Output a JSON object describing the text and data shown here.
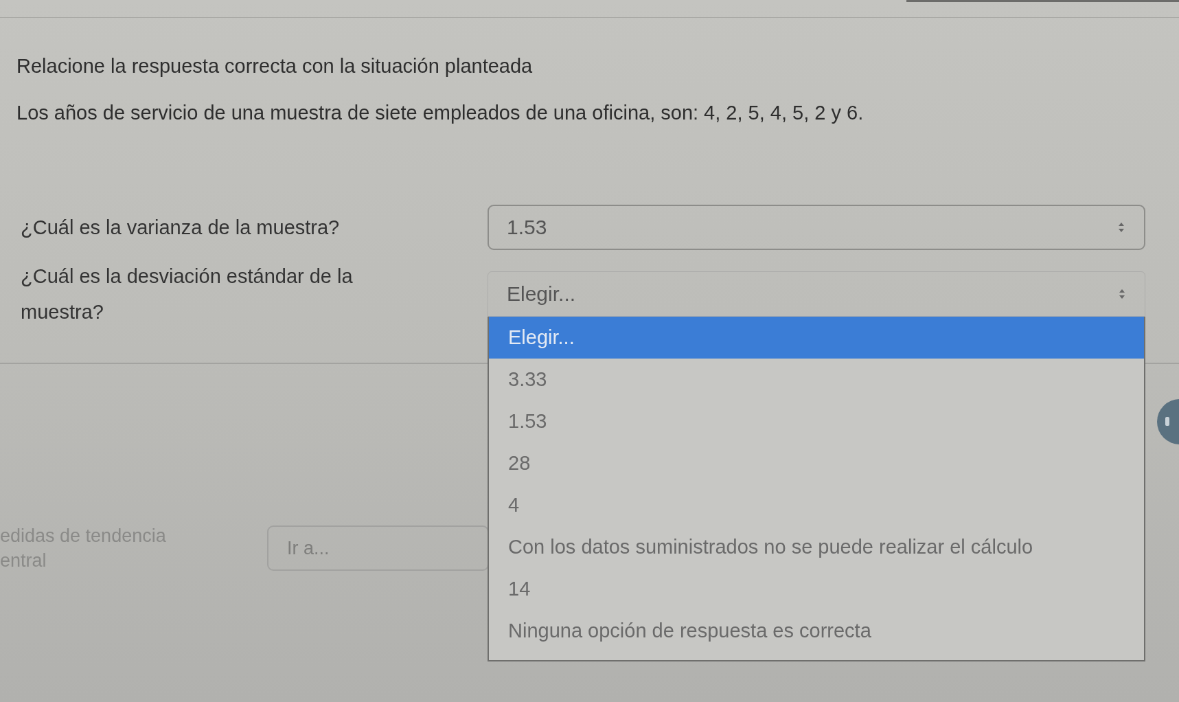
{
  "instruction": "Relacione la respuesta correcta con la situación planteada",
  "statement": "Los años de servicio de una muestra de siete empleados de una oficina, son: 4, 2, 5, 4, 5, 2 y 6.",
  "questions": [
    {
      "text": "¿Cuál es la varianza de la muestra?",
      "value": "1.53",
      "expanded": false
    },
    {
      "text": "¿Cuál es la desviación estándar de la muestra?",
      "value": "Elegir...",
      "expanded": true,
      "options": [
        {
          "label": "Elegir...",
          "selected": true
        },
        {
          "label": "3.33",
          "selected": false
        },
        {
          "label": "1.53",
          "selected": false
        },
        {
          "label": "28",
          "selected": false
        },
        {
          "label": "4",
          "selected": false
        },
        {
          "label": "Con los datos suministrados no se puede realizar el cálculo",
          "selected": false
        },
        {
          "label": "14",
          "selected": false
        },
        {
          "label": "Ninguna opción de respuesta es correcta",
          "selected": false
        }
      ]
    }
  ],
  "navigation": {
    "previous_link_lines": [
      "edidas de tendencia",
      "entral"
    ],
    "jump_select": {
      "value": "Ir a..."
    }
  }
}
